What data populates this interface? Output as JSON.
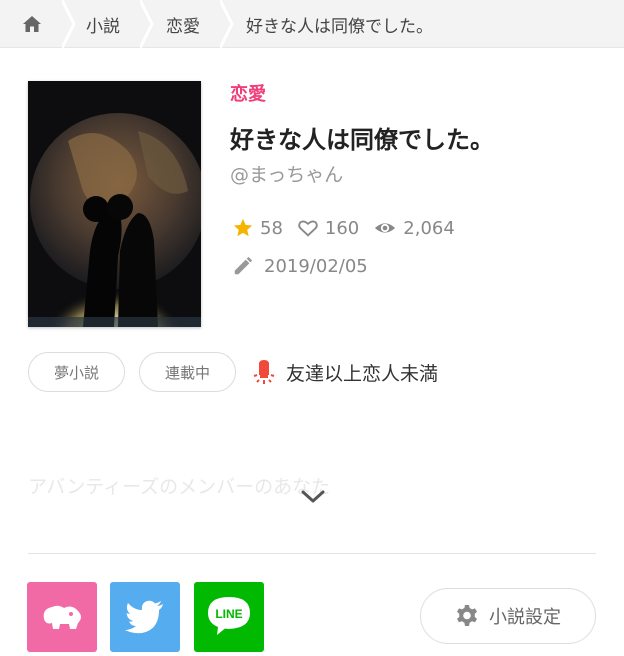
{
  "breadcrumb": {
    "home_icon": "home-icon",
    "items": [
      {
        "label": "小説"
      },
      {
        "label": "恋愛"
      },
      {
        "label": "好きな人は同僚でした。"
      }
    ]
  },
  "novel": {
    "genre": "恋愛",
    "title": "好きな人は同僚でした。",
    "author": "@まっちゃん",
    "stars": "58",
    "likes": "160",
    "views": "2,064",
    "updated": "2019/02/05",
    "tags": [
      "夢小説",
      "連載中"
    ],
    "keyword": "友達以上恋人未満",
    "synopsis": "アバンティーズのメンバーのあなた"
  },
  "share": {
    "app_icon": "elephant-icon",
    "twitter_icon": "twitter-icon",
    "line_label": "LINE"
  },
  "settings": {
    "label": "小説設定"
  },
  "colors": {
    "accent": "#ef3e7a",
    "star": "#f5b400",
    "twitter": "#55acee",
    "line": "#00b900",
    "app": "#f16aa5"
  }
}
